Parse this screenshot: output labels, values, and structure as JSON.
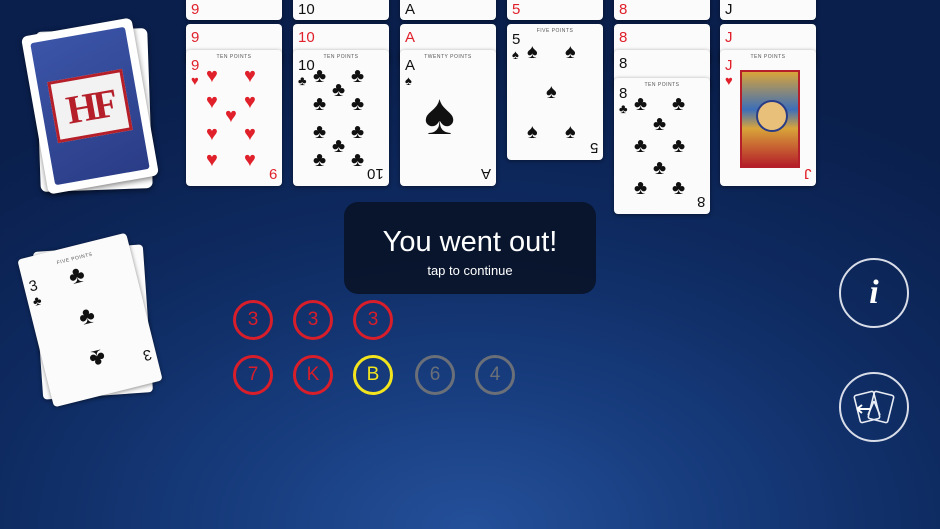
{
  "deck": {
    "logo": "HF"
  },
  "discard": {
    "rank": "3",
    "suit": "♣",
    "points": "FIVE POINTS"
  },
  "melds": [
    {
      "rank": "9",
      "suit": "♥",
      "color": "red",
      "points": "TEN POINTS"
    },
    {
      "rank": "10",
      "suit": "♣",
      "color": "black",
      "points": "TEN POINTS"
    },
    {
      "rank": "A",
      "suit": "♠",
      "color": "black",
      "points": "TWENTY POINTS"
    },
    {
      "rank": "5",
      "suit": "♠",
      "color": "black",
      "points": "FIVE POINTS"
    },
    {
      "rank": "8",
      "suit": "♣",
      "color": "black",
      "points": "TEN POINTS"
    },
    {
      "rank": "J",
      "suit": "♥",
      "color": "red",
      "points": "TEN POINTS"
    }
  ],
  "stack_labels": {
    "col1": [
      "9",
      "9",
      "9"
    ],
    "col2": [
      "10",
      "10",
      "10"
    ],
    "col3": [
      "A",
      "A",
      "A"
    ],
    "col4": [
      "5",
      "5"
    ],
    "col5": [
      "8",
      "8",
      "8",
      "8"
    ],
    "col6": [
      "J",
      "J",
      "J"
    ]
  },
  "modal": {
    "title": "You went out!",
    "subtitle": "tap to continue"
  },
  "tokens": {
    "row1": [
      {
        "label": "3",
        "color": "#d81e2a"
      },
      {
        "label": "3",
        "color": "#d81e2a"
      },
      {
        "label": "3",
        "color": "#d81e2a"
      }
    ],
    "row2": [
      {
        "label": "7",
        "color": "#d81e2a"
      },
      {
        "label": "K",
        "color": "#d81e2a"
      },
      {
        "label": "B",
        "color": "#f2e51e"
      },
      {
        "label": "6",
        "color": "#6a6f78"
      },
      {
        "label": "4",
        "color": "#6a6f78"
      }
    ]
  },
  "buttons": {
    "info_label": "i"
  }
}
